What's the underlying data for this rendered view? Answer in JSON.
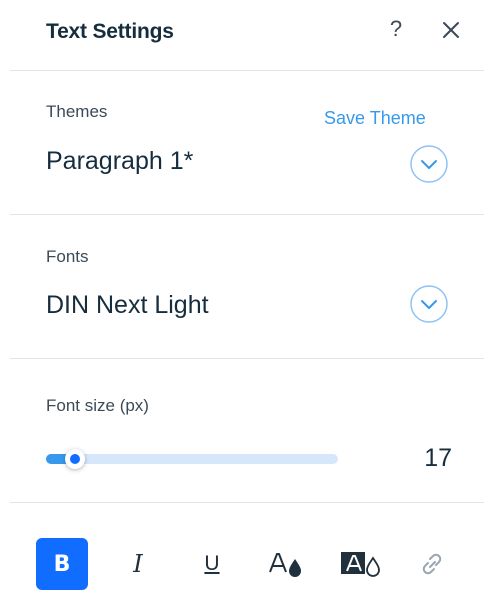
{
  "header": {
    "title": "Text Settings",
    "help_label": "?"
  },
  "themes": {
    "label": "Themes",
    "save_theme_label": "Save Theme",
    "selected": "Paragraph 1*"
  },
  "fonts": {
    "label": "Fonts",
    "selected": "DIN Next Light"
  },
  "font_size": {
    "label": "Font size (px)",
    "value": "17",
    "slider_fraction": 0.1
  },
  "toolbar": {
    "bold_label": "B",
    "italic_label": "I",
    "underline_label": "U",
    "icons": [
      "bold-icon",
      "italic-icon",
      "underline-icon",
      "text-color-icon",
      "highlight-color-icon",
      "link-icon"
    ]
  },
  "colors": {
    "accent": "#116dff",
    "link": "#3899ec",
    "text": "#162d3d",
    "divider": "#dfe5eb"
  }
}
